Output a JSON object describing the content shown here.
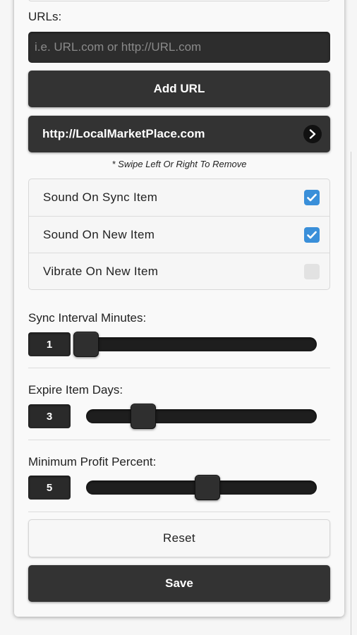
{
  "urls_section": {
    "label": "URLs:",
    "input_placeholder": "i.e. URL.com or http://URL.com",
    "add_button": "Add URL",
    "items": [
      {
        "url": "http://LocalMarketPlace.com",
        "icon": "chevron-right-icon"
      }
    ],
    "hint": "* Swipe Left Or Right To Remove"
  },
  "options": [
    {
      "label": "Sound On Sync Item",
      "checked": true
    },
    {
      "label": "Sound On New Item",
      "checked": true
    },
    {
      "label": "Vibrate On New Item",
      "checked": false
    }
  ],
  "sliders": {
    "sync_interval": {
      "label": "Sync Interval Minutes:",
      "value": "1",
      "fraction": 0.0
    },
    "expire_days": {
      "label": "Expire Item Days:",
      "value": "3",
      "fraction": 0.22
    },
    "min_profit": {
      "label": "Minimum Profit Percent:",
      "value": "5",
      "fraction": 0.53
    }
  },
  "buttons": {
    "reset": "Reset",
    "save": "Save"
  },
  "colors": {
    "accent_checkbox": "#3a8fd9",
    "dark_button": "#333333"
  }
}
